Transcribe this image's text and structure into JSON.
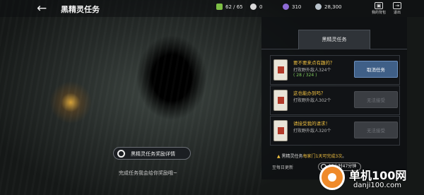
{
  "header": {
    "back_icon": "←",
    "title": "黑精灵任务"
  },
  "resources": [
    {
      "icon": "stamina-icon",
      "value": "62 / 65"
    },
    {
      "icon": "gem-icon",
      "value": "0"
    },
    {
      "icon": "moon-icon",
      "value": "310"
    },
    {
      "icon": "silver-icon",
      "value": "28,300"
    }
  ],
  "top_buttons": {
    "bag_label": "我的背包",
    "exit_label": "退出"
  },
  "panel": {
    "tab": "黑精灵任务",
    "quests": [
      {
        "name": "要不要来点有趣的？",
        "desc": "打败野外敌人324个",
        "progress": "( 28 / 324 )",
        "button": "取消任务"
      },
      {
        "name": "这也能办到吗？",
        "desc": "打败野外敌人302个",
        "progress": "",
        "button": "无法接受"
      },
      {
        "name": "请接受我的请求！",
        "desc": "打败野外敌人320个",
        "progress": "",
        "button": "无法接受"
      }
    ],
    "notice_prefix": "黑精灵任务",
    "notice_highlight": "每家门1天可完成3次",
    "notice_suffix": "。",
    "refresh_label": "至每日更新",
    "timer": "12小时47分钟"
  },
  "reward": {
    "button_label": "黑精灵任务奖励详情",
    "hint": "完成任务我会给你奖励哦~"
  },
  "watermark": {
    "title": "单机100网",
    "url": "danji100.com"
  }
}
